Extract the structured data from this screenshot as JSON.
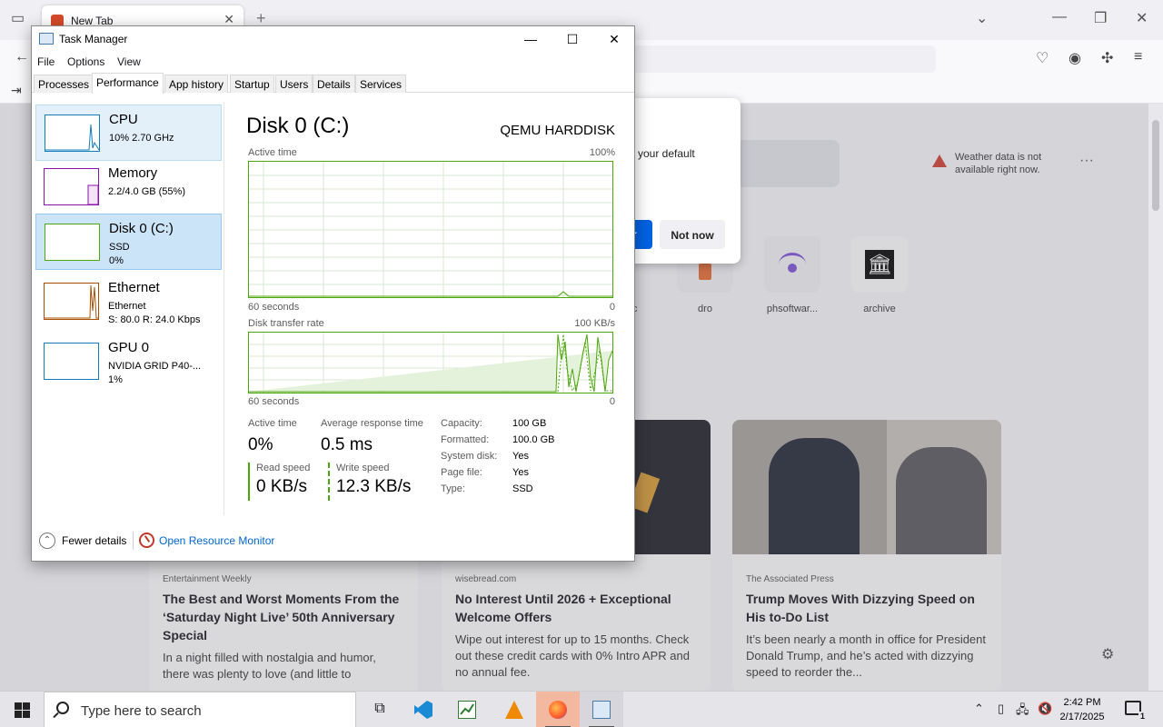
{
  "firefox": {
    "tab_title": "New Tab",
    "new_tab": "+",
    "default_browser_msg": "your default",
    "not_now": "Not now",
    "primary_partial": "r",
    "weather_msg": "Weather data is not available right now.",
    "more": "···",
    "shortcuts": [
      {
        "label": "dro"
      },
      {
        "label": "phsoftwar..."
      },
      {
        "label": "archive"
      }
    ],
    "partial_shortcut_label": "c",
    "cards": [
      {
        "source": "Entertainment Weekly",
        "title": "The Best and Worst Moments From the ‘Saturday Night Live’ 50th Anniversary Special",
        "desc": "In a night filled with nostalgia and humor, there was plenty to love (and little to"
      },
      {
        "source": "wisebread.com",
        "title": "No Interest Until 2026 + Exceptional Welcome Offers",
        "desc": "Wipe out interest for up to 15 months. Check out these credit cards with 0% Intro APR and no annual fee."
      },
      {
        "source": "The Associated Press",
        "title": "Trump Moves With Dizzying Speed on His to-Do List",
        "desc": "It’s been nearly a month in office for President Donald Trump, and he’s acted with dizzying speed to reorder the..."
      }
    ]
  },
  "task_manager": {
    "title": "Task Manager",
    "menu": [
      "File",
      "Options",
      "View"
    ],
    "tabs": [
      "Processes",
      "Performance",
      "App history",
      "Startup",
      "Users",
      "Details",
      "Services"
    ],
    "active_tab": "Performance",
    "sidebar": [
      {
        "name": "CPU",
        "line1": "10%  2.70 GHz",
        "line2": "",
        "color": "#117dbb"
      },
      {
        "name": "Memory",
        "line1": "2.2/4.0 GB (55%)",
        "line2": "",
        "color": "#8b12ae"
      },
      {
        "name": "Disk 0 (C:)",
        "line1": "SSD",
        "line2": "0%",
        "color": "#4da60c"
      },
      {
        "name": "Ethernet",
        "line1": "Ethernet",
        "line2": "S: 80.0  R: 24.0 Kbps",
        "color": "#a74f01"
      },
      {
        "name": "GPU 0",
        "line1": "NVIDIA GRID P40-...",
        "line2": "1%",
        "color": "#117dbb"
      }
    ],
    "selected_item": "Disk 0 (C:)",
    "disk": {
      "title": "Disk 0 (C:)",
      "model": "QEMU HARDDISK",
      "graph1_label": "Active time",
      "graph1_max": "100%",
      "graph1_time": "60 seconds",
      "graph1_min": "0",
      "graph2_label": "Disk transfer rate",
      "graph2_max": "100 KB/s",
      "graph2_time": "60 seconds",
      "graph2_min": "0",
      "active_time_label": "Active time",
      "active_time_value": "0%",
      "avg_resp_label": "Average response time",
      "avg_resp_value": "0.5 ms",
      "read_label": "Read speed",
      "read_value": "0 KB/s",
      "write_label": "Write speed",
      "write_value": "12.3 KB/s",
      "properties": [
        {
          "key": "Capacity:",
          "value": "100 GB"
        },
        {
          "key": "Formatted:",
          "value": "100.0 GB"
        },
        {
          "key": "System disk:",
          "value": "Yes"
        },
        {
          "key": "Page file:",
          "value": "Yes"
        },
        {
          "key": "Type:",
          "value": "SSD"
        }
      ]
    },
    "footer": {
      "fewer_details": "Fewer details",
      "open_resource_monitor": "Open Resource Monitor"
    }
  },
  "taskbar": {
    "search_placeholder": "Type here to search",
    "time": "2:42 PM",
    "date": "2/17/2025",
    "notification_count": "1"
  }
}
